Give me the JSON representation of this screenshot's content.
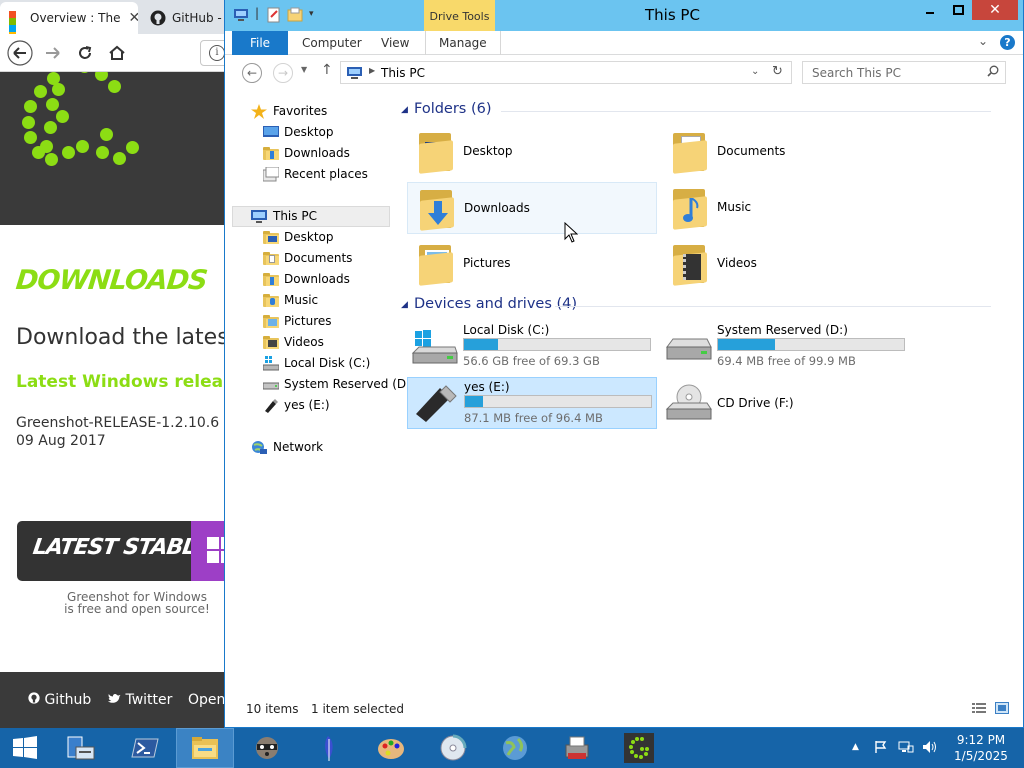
{
  "browser": {
    "tabs": [
      {
        "label": "Overview : The",
        "icon": "microsoft-logo-icon"
      },
      {
        "label": "GitHub - a",
        "icon": "github-icon"
      }
    ],
    "site": {
      "heading": "DOWNLOADS",
      "title": "Download the lates",
      "subtitle": "Latest Windows release",
      "file": "Greenshot-RELEASE-1.2.10.6",
      "date": "09 Aug 2017",
      "stable_button": "LATEST STABLE",
      "caption_line1": "Greenshot for Windows",
      "caption_line2": "is free and open source!",
      "footer": [
        "Github",
        "Twitter",
        "OpenH"
      ]
    }
  },
  "explorer": {
    "title": "This PC",
    "contextual_tab": "Drive Tools",
    "ribbon_tabs": {
      "file": "File",
      "computer": "Computer",
      "view": "View",
      "manage": "Manage"
    },
    "address": {
      "path": "This PC"
    },
    "search": {
      "placeholder": "Search This PC"
    },
    "nav": {
      "favorites": "Favorites",
      "fav_items": [
        "Desktop",
        "Downloads",
        "Recent places"
      ],
      "this_pc": "This PC",
      "pc_items": [
        "Desktop",
        "Documents",
        "Downloads",
        "Music",
        "Pictures",
        "Videos",
        "Local Disk (C:)",
        "System Reserved (D:",
        "yes (E:)"
      ],
      "network": "Network"
    },
    "folders_header": "Folders (6)",
    "folders": [
      "Desktop",
      "Documents",
      "Downloads",
      "Music",
      "Pictures",
      "Videos"
    ],
    "drives_header": "Devices and drives (4)",
    "drives": [
      {
        "name": "Local Disk (C:)",
        "free": "56.6 GB free of 69.3 GB",
        "used_fraction": 0.183
      },
      {
        "name": "System Reserved (D:)",
        "free": "69.4 MB free of 99.9 MB",
        "used_fraction": 0.305
      },
      {
        "name": "yes (E:)",
        "free": "87.1 MB free of 96.4 MB",
        "used_fraction": 0.096
      },
      {
        "name": "CD Drive (F:)"
      }
    ],
    "status": {
      "items": "10 items",
      "selected": "1 item selected"
    }
  },
  "taskbar": {
    "time": "9:12 PM",
    "date": "1/5/2025"
  },
  "colors": {
    "accent": "#1979ca",
    "titlebar": "#6bc4f0",
    "drive_bar": "#26a0da",
    "taskbar": "#1664a8",
    "greenshot_green": "#8cdd14"
  }
}
